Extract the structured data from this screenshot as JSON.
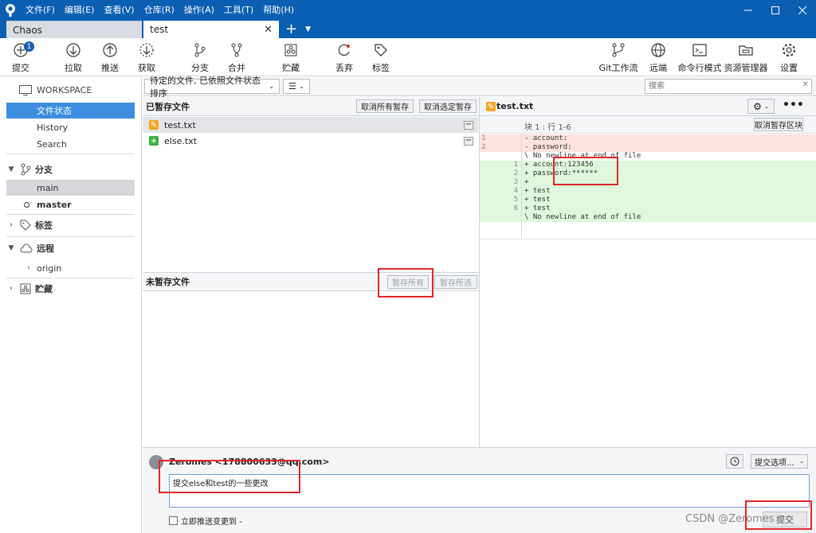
{
  "menu": [
    "文件(F)",
    "编辑(E)",
    "查看(V)",
    "仓库(R)",
    "操作(A)",
    "工具(T)",
    "帮助(H)"
  ],
  "tabs": {
    "inactive": "Chaos",
    "active": "test",
    "close": "✕",
    "plus": "+",
    "more": "▼"
  },
  "toolbar": {
    "commit": "提交",
    "commit_badge": "1",
    "pull": "拉取",
    "push": "推送",
    "fetch": "获取",
    "branch": "分支",
    "merge": "合并",
    "stash": "贮藏",
    "discard": "丢弃",
    "tag": "标签",
    "gitflow": "Git工作流",
    "remote": "远端",
    "terminal": "命令行模式",
    "explorer": "资源管理器",
    "settings": "设置"
  },
  "sidebar": {
    "workspace": "WORKSPACE",
    "ws_items": [
      "文件状态",
      "History",
      "Search"
    ],
    "branches": "分支",
    "branch_items": [
      "main",
      "master"
    ],
    "tags": "标签",
    "remotes": "远程",
    "remote_items": [
      "origin"
    ],
    "stashes": "贮藏"
  },
  "filter": {
    "sort": "待定的文件, 已依照文件状态排序",
    "search_placeholder": "搜索"
  },
  "staged": {
    "title": "已暂存文件",
    "unstage_all": "取消所有暂存",
    "unstage_selected": "取消选定暂存",
    "files": [
      "test.txt",
      "else.txt"
    ]
  },
  "unstaged": {
    "title": "未暂存文件",
    "stage_all": "暂存所有",
    "stage_selected": "暂存所选"
  },
  "diff": {
    "file": "test.txt",
    "hunk": "块 1 : 行 1-6",
    "unstage_hunk": "取消暂存区块",
    "lines": [
      {
        "old": "1",
        "new": "",
        "type": "del",
        "text": "- account:"
      },
      {
        "old": "2",
        "new": "",
        "type": "del",
        "text": "- password:"
      },
      {
        "old": "",
        "new": "",
        "type": "ctx",
        "text": "\\ No newline at end of file"
      },
      {
        "old": "",
        "new": "1",
        "type": "add",
        "text": "+ account:123456"
      },
      {
        "old": "",
        "new": "2",
        "type": "add",
        "text": "+ password:******"
      },
      {
        "old": "",
        "new": "3",
        "type": "add",
        "text": "+"
      },
      {
        "old": "",
        "new": "4",
        "type": "add",
        "text": "+ test"
      },
      {
        "old": "",
        "new": "5",
        "type": "add",
        "text": "+ test"
      },
      {
        "old": "",
        "new": "6",
        "type": "add",
        "text": "+ test"
      },
      {
        "old": "",
        "new": "",
        "type": "add",
        "text": "\\ No newline at end of file"
      }
    ]
  },
  "commit": {
    "author": "Zeromes <178800633@qq.com>",
    "message": "提交else和test的一些更改",
    "options": "提交选项...",
    "push_now": "立即推送变更到 -",
    "submit": "提交"
  },
  "watermark": "CSDN @Zeromes",
  "colors": {
    "titlebar": "#0b5fb3",
    "selected": "#3d8de0",
    "annotation": "#e2262b"
  }
}
